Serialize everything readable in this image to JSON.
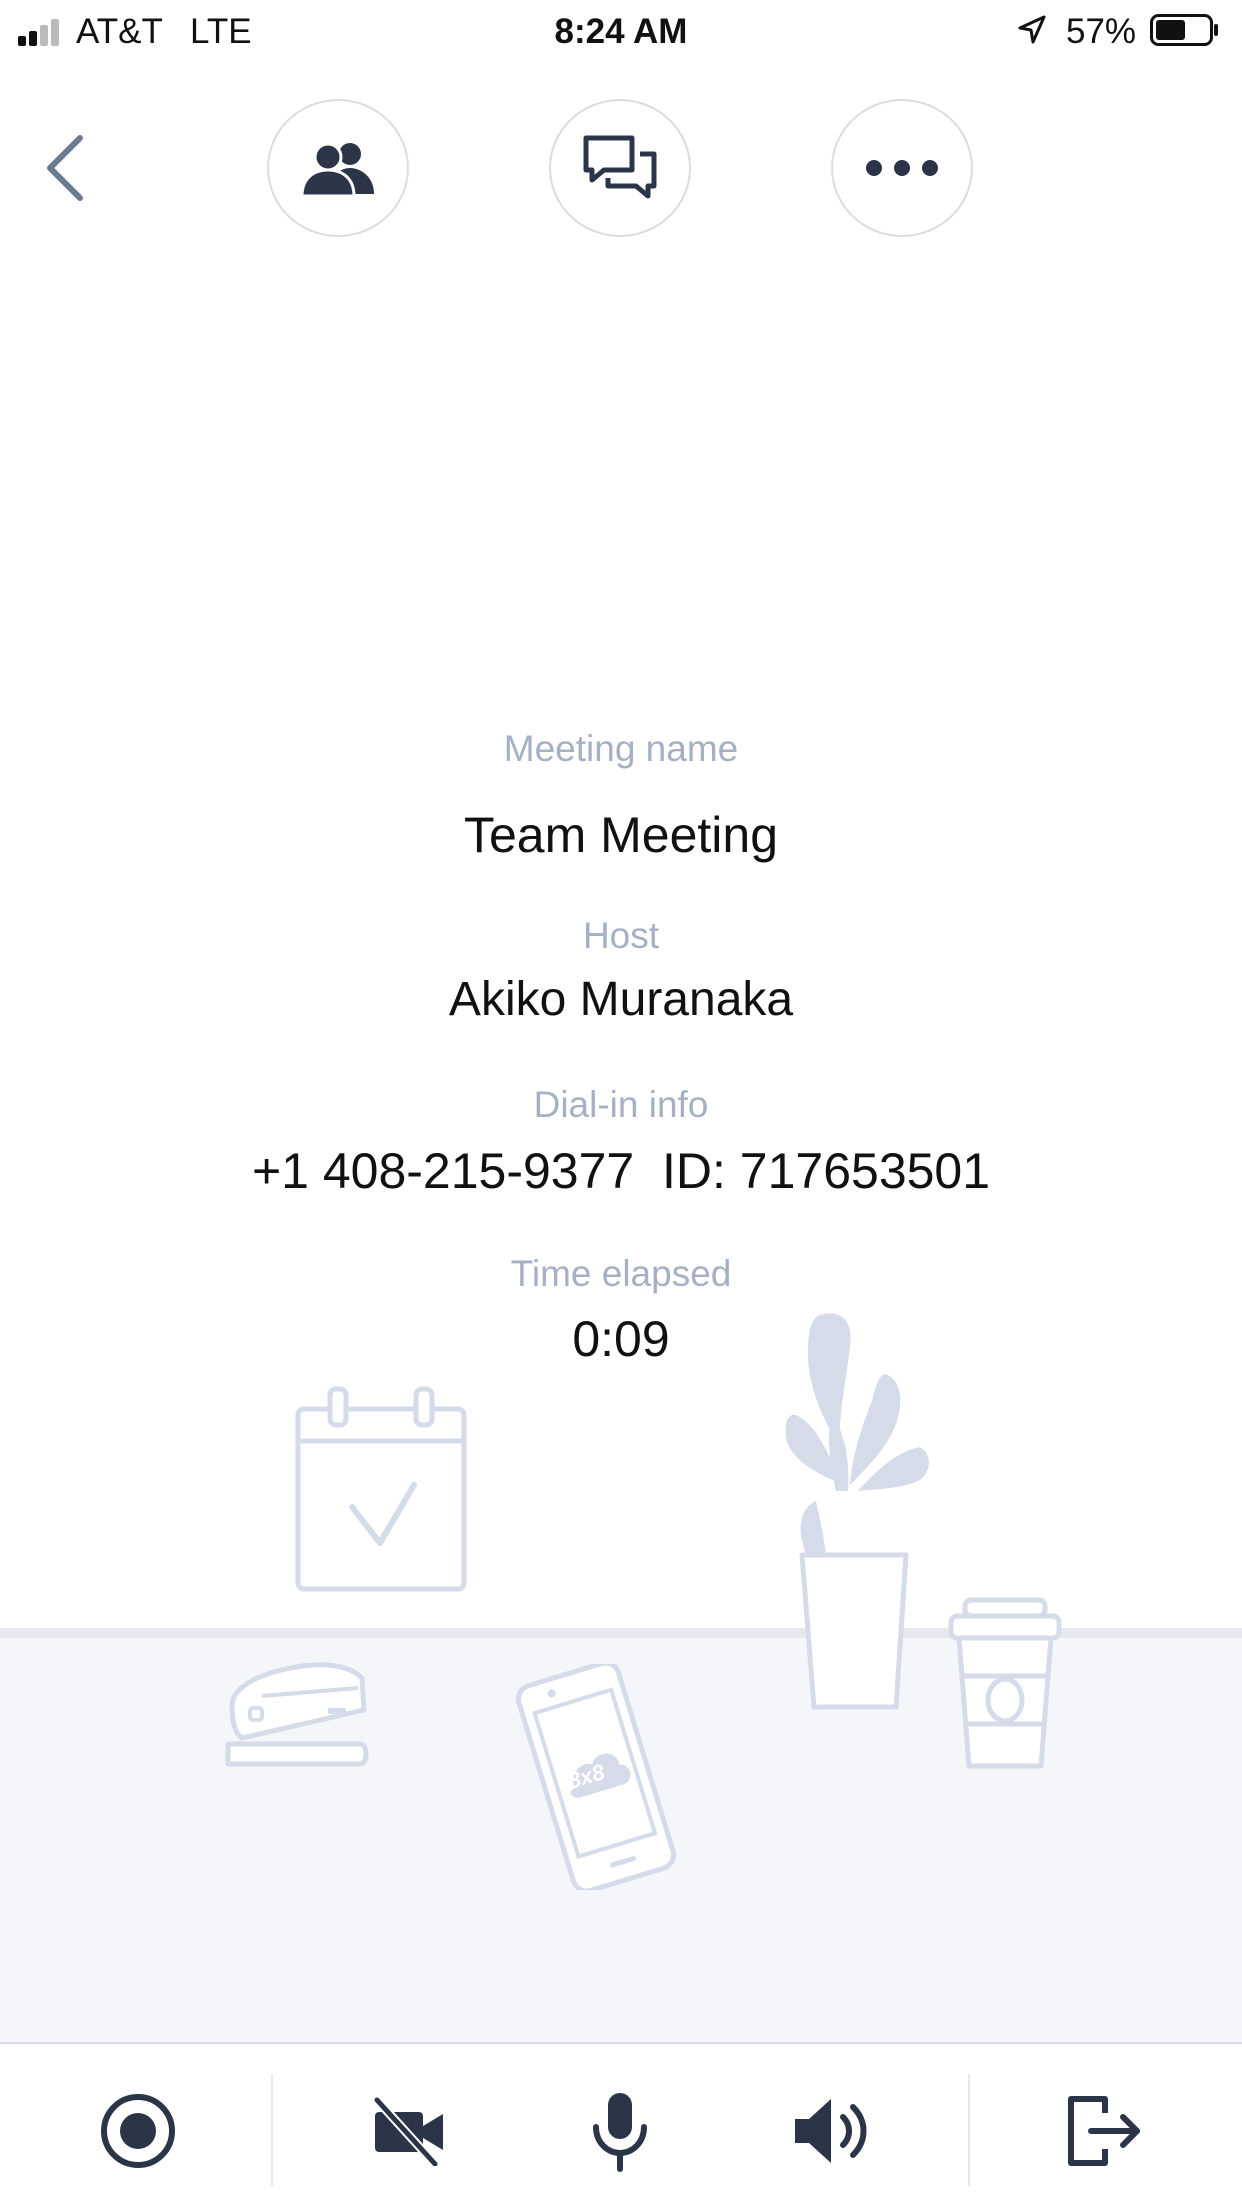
{
  "status_bar": {
    "carrier": "AT&T",
    "network": "LTE",
    "time": "8:24 AM",
    "battery_percent": "57%",
    "battery_level": 0.57
  },
  "top_bar": {
    "back_icon": "chevron-left-icon",
    "participants_icon": "participants-icon",
    "chat_icon": "chat-icon",
    "more_icon": "more-icon"
  },
  "meeting": {
    "name_label": "Meeting name",
    "name": "Team Meeting",
    "host_label": "Host",
    "host": "Akiko Muranaka",
    "dial_label": "Dial-in info",
    "dial_info": "+1 408-215-9377  ID: 717653501",
    "elapsed_label": "Time elapsed",
    "elapsed": "0:09"
  },
  "illustration": {
    "phone_logo": "8x8"
  },
  "toolbar": {
    "record_icon": "record-icon",
    "video_icon": "video-off-icon",
    "mic_icon": "microphone-icon",
    "speaker_icon": "speaker-icon",
    "leave_icon": "leave-icon"
  },
  "colors": {
    "icon_dark": "#2c3548",
    "label_gray": "#a6b0c4",
    "illustration": "#d6dbea",
    "back_arrow": "#6d7b92"
  }
}
